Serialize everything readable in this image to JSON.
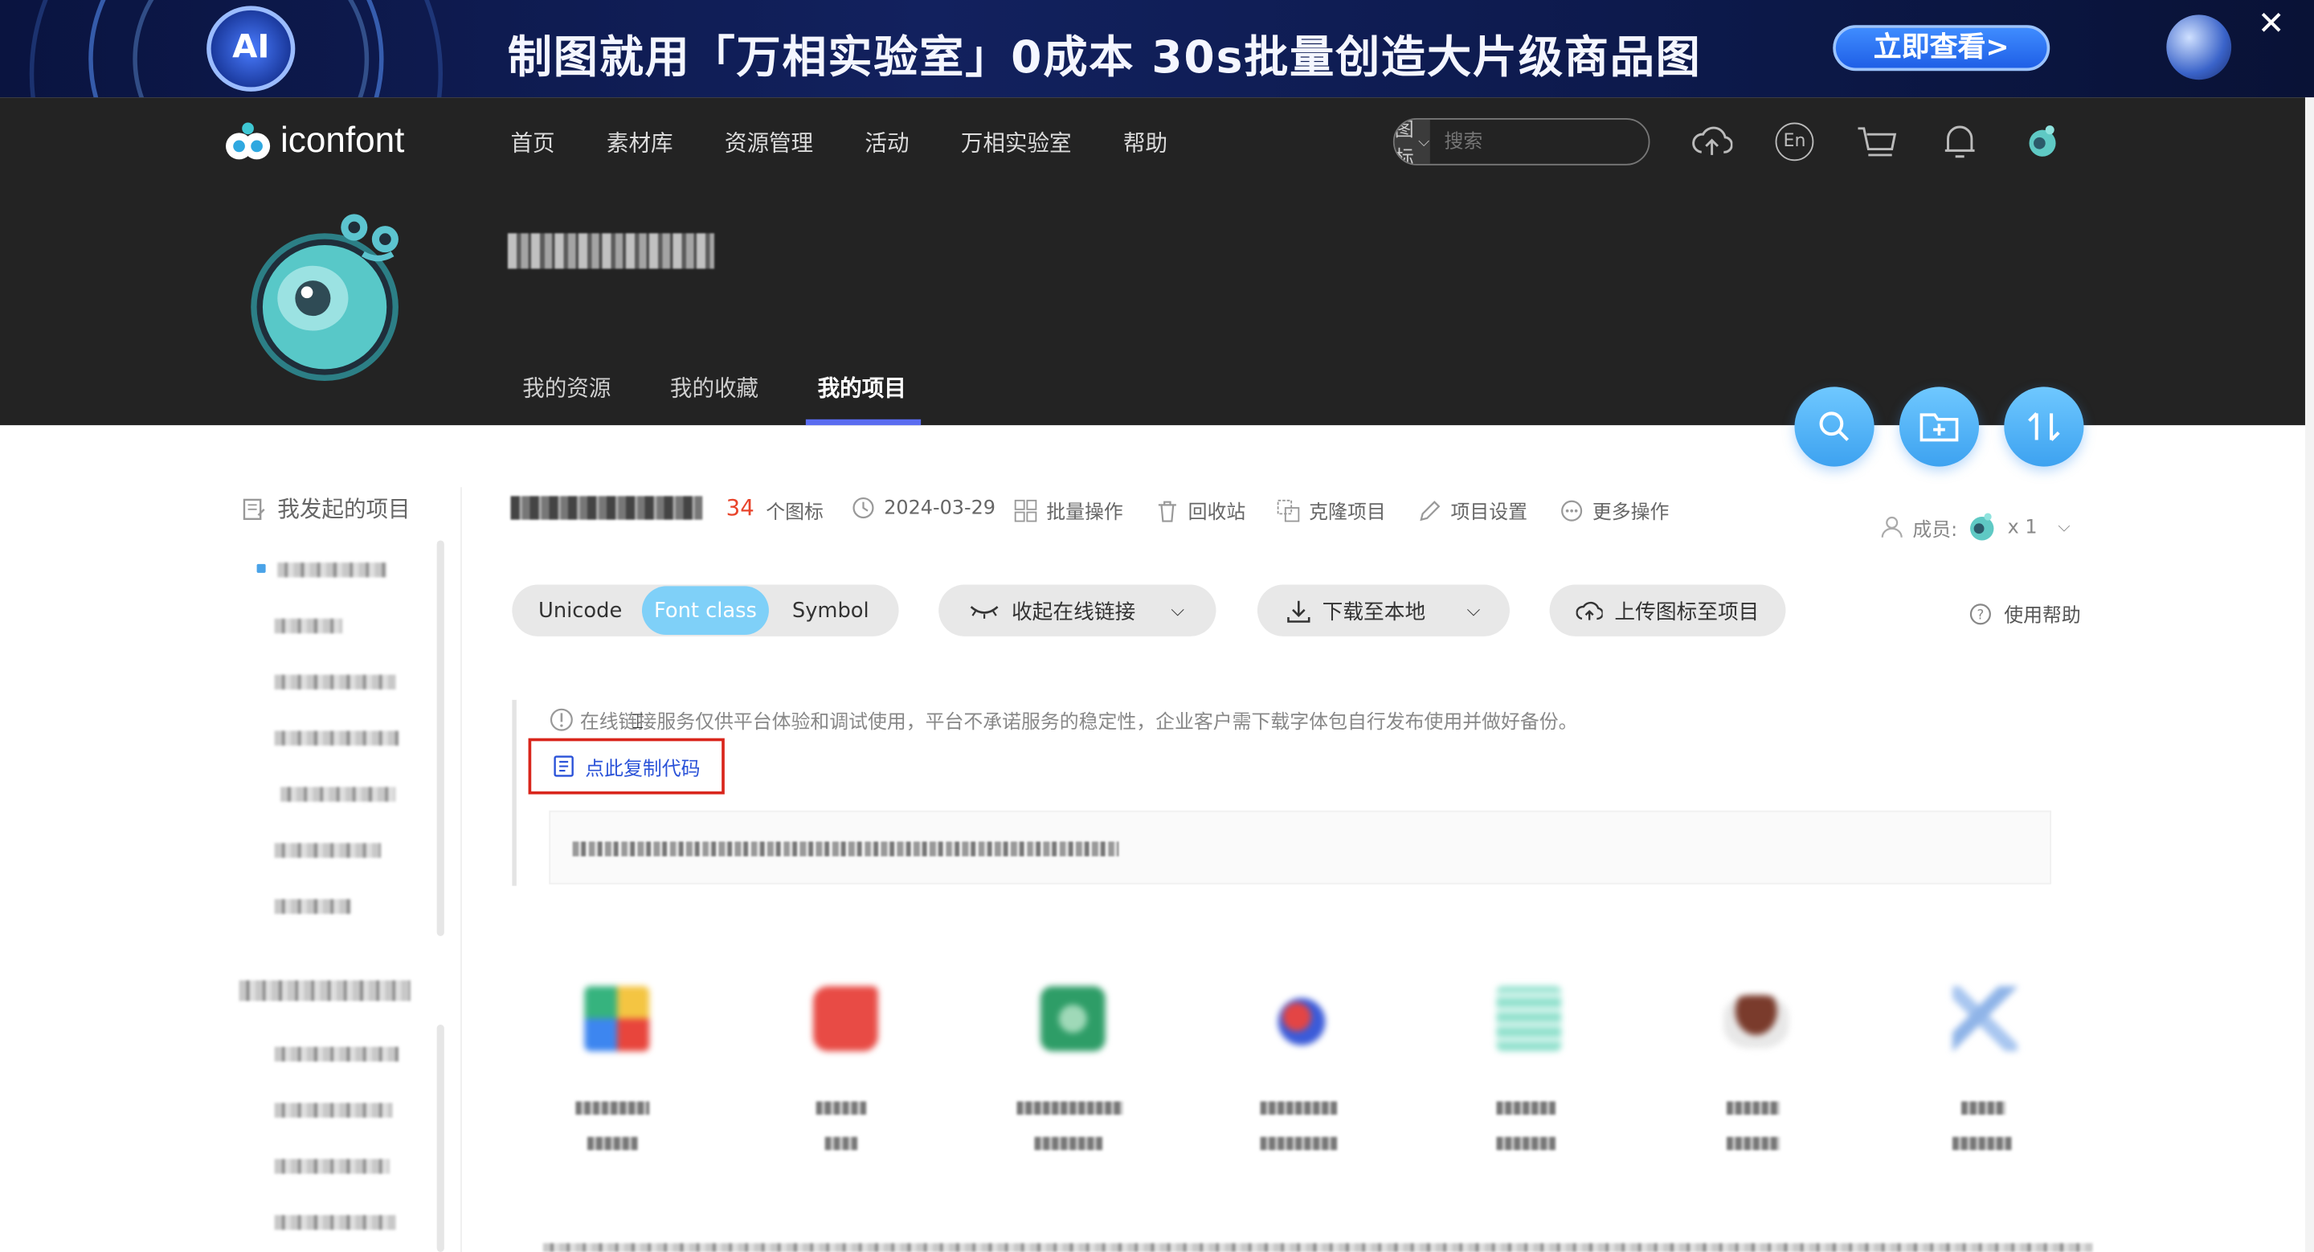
{
  "banner": {
    "ai_badge": "AI",
    "headline": "制图就用「万相实验室」0成本 30s批量创造大片级商品图",
    "cta": "立即查看>"
  },
  "header": {
    "logo_text": "iconfont",
    "nav": [
      "首页",
      "素材库",
      "资源管理",
      "活动",
      "万相实验室",
      "帮助"
    ],
    "search": {
      "type_label": "图标",
      "placeholder": "搜索"
    },
    "lang_label": "En"
  },
  "profile": {
    "tabs": [
      "我的资源",
      "我的收藏",
      "我的项目"
    ]
  },
  "sidebar": {
    "my_projects_title": "我发起的项目"
  },
  "project": {
    "icon_count": "34",
    "icon_count_unit": "个图标",
    "date": "2024-03-29",
    "actions": [
      "批量操作",
      "回收站",
      "克隆项目",
      "项目设置",
      "更多操作"
    ],
    "members_label": "成员:",
    "members_count": "x 1"
  },
  "toolbar": {
    "formats": [
      "Unicode",
      "Font class",
      "Symbol"
    ],
    "selected_format": "Font class",
    "collapse_link": "收起在线链接",
    "download": "下载至本地",
    "upload": "上传图标至项目",
    "help": "使用帮助"
  },
  "notice": {
    "text": "在线链接服务仅供平台体验和调试使用，平台不承诺服务的稳定性，企业客户需下载字体包自行发布使用并做好备份。",
    "copy_code": "点此复制代码"
  },
  "colors": {
    "accent": "#7fd0f8",
    "count_red": "#e8442b",
    "header_bg": "#232323",
    "tab_underline": "#5a6cf0",
    "highlight_border": "#d9261c"
  }
}
